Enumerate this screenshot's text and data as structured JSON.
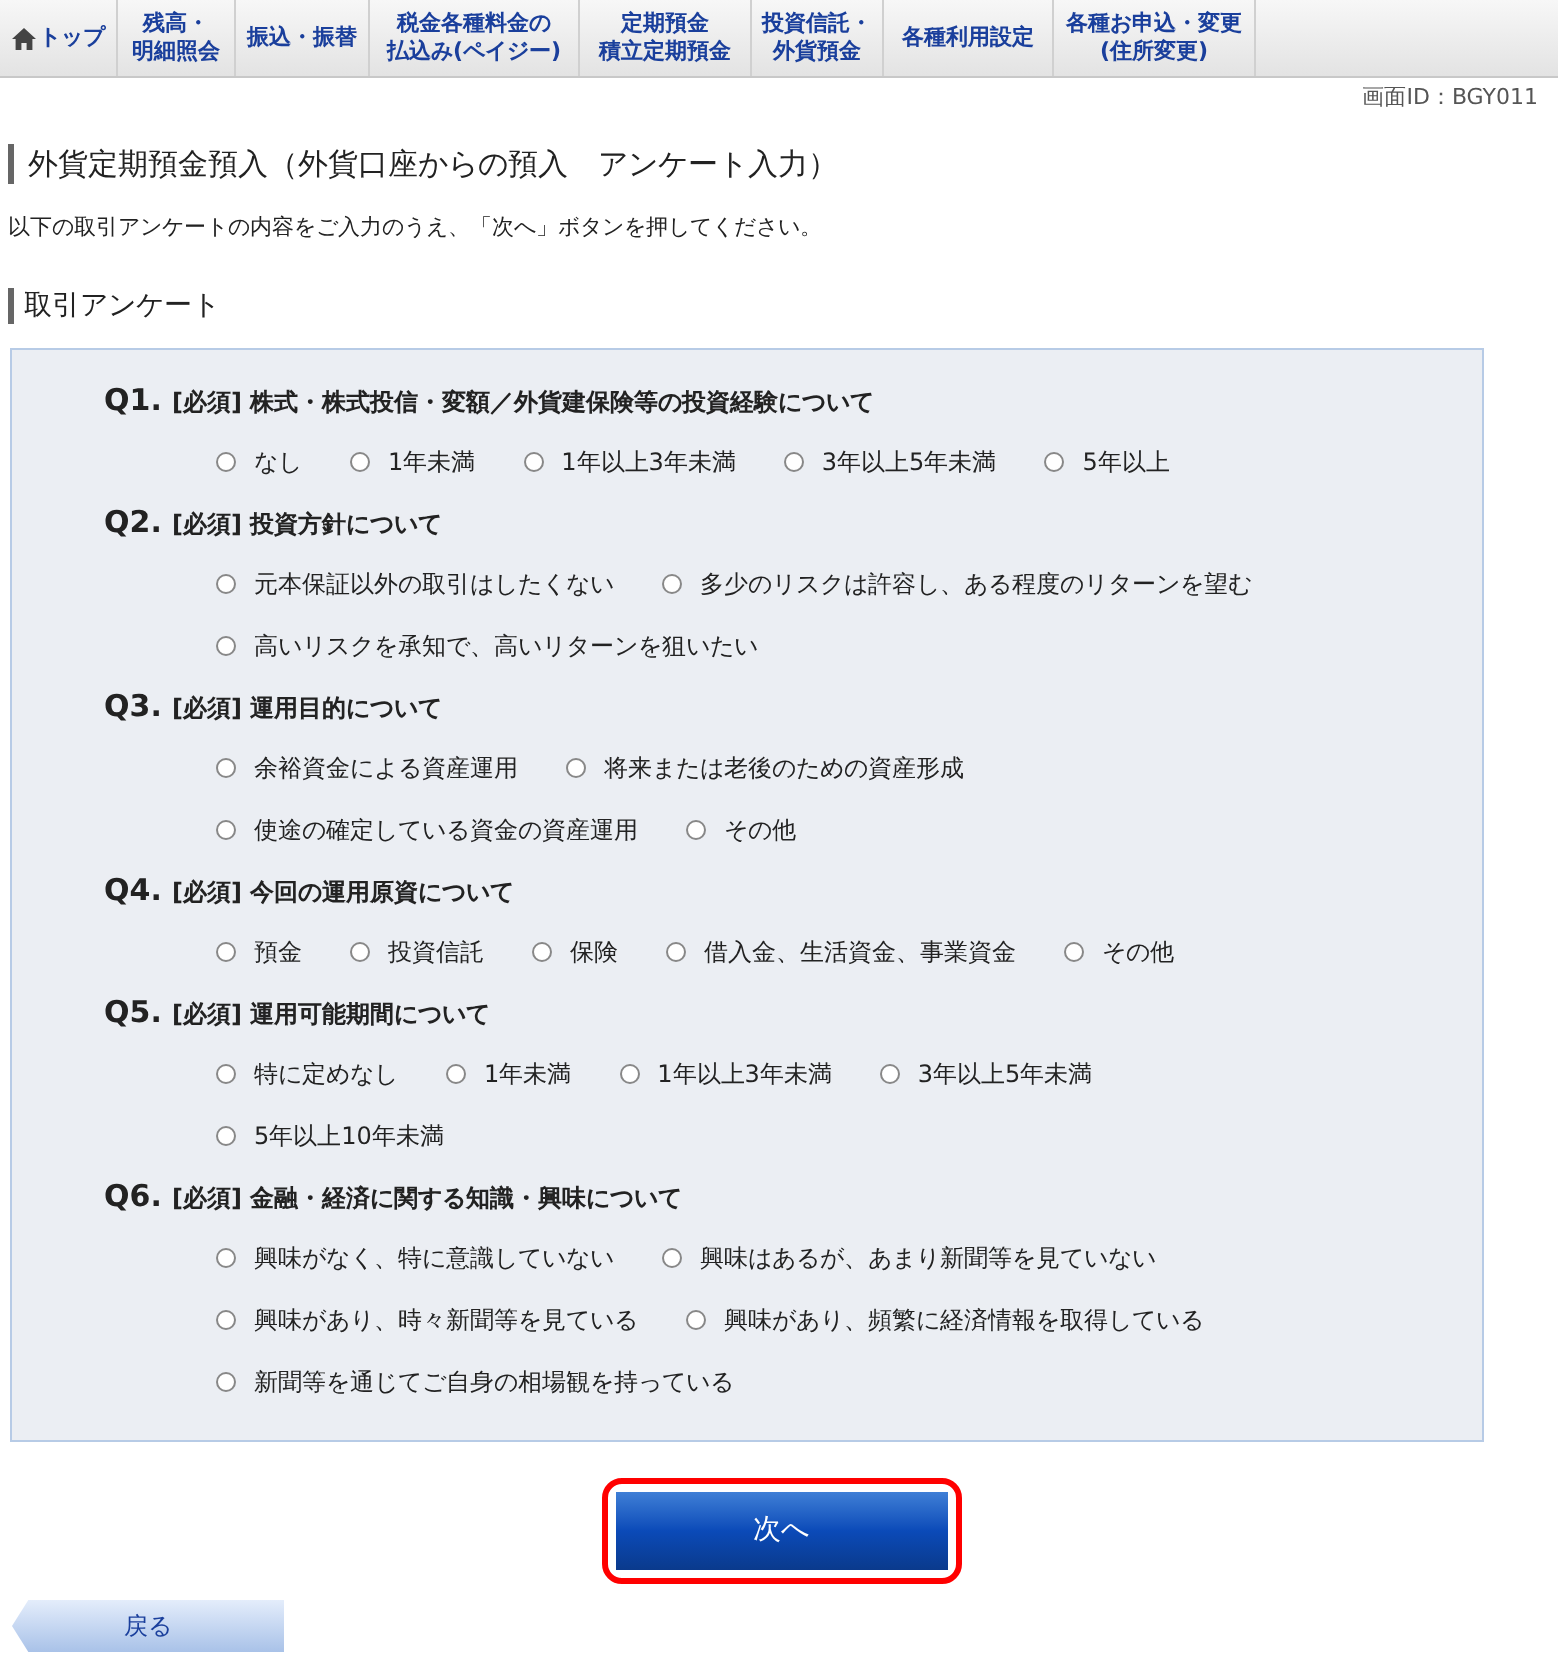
{
  "nav": [
    {
      "lines": [
        "トップ"
      ],
      "kind": "home",
      "selected": false
    },
    {
      "lines": [
        "残高・",
        "明細照会"
      ],
      "selected": false
    },
    {
      "lines": [
        "振込・振替"
      ],
      "selected": false
    },
    {
      "lines": [
        "税金各種料金の",
        "払込み(ペイジー)"
      ],
      "selected": false
    },
    {
      "lines": [
        "定期預金",
        "積立定期預金"
      ],
      "selected": false
    },
    {
      "lines": [
        "投資信託・",
        "外貨預金"
      ],
      "selected": false
    },
    {
      "lines": [
        "各種利用設定"
      ],
      "selected": false
    },
    {
      "lines": [
        "各種お申込・変更",
        "(住所変更)"
      ],
      "selected": false
    }
  ],
  "screen_id": "画面ID：BGY011",
  "title": "外貨定期預金預入（外貨口座からの預入　アンケート入力）",
  "instruction": "以下の取引アンケートの内容をご入力のうえ、「次へ」ボタンを押してください。",
  "section_title": "取引アンケート",
  "questions": [
    {
      "number": "Q1.",
      "required": "[必須]",
      "text": "株式・株式投信・変額／外貨建保険等の投資経験について",
      "option_rows": [
        [
          {
            "label": "なし",
            "selected": false
          },
          {
            "label": "1年未満",
            "selected": false
          },
          {
            "label": "1年以上3年未満",
            "selected": false
          },
          {
            "label": "3年以上5年未満",
            "selected": false
          },
          {
            "label": "5年以上",
            "selected": false
          }
        ]
      ]
    },
    {
      "number": "Q2.",
      "required": "[必須]",
      "text": "投資方針について",
      "option_rows": [
        [
          {
            "label": "元本保証以外の取引はしたくない",
            "selected": false
          },
          {
            "label": "多少のリスクは許容し、ある程度のリターンを望む",
            "selected": false
          }
        ],
        [
          {
            "label": "高いリスクを承知で、高いリターンを狙いたい",
            "selected": false
          }
        ]
      ]
    },
    {
      "number": "Q3.",
      "required": "[必須]",
      "text": "運用目的について",
      "option_rows": [
        [
          {
            "label": "余裕資金による資産運用",
            "selected": false
          },
          {
            "label": "将来または老後のための資産形成",
            "selected": false
          }
        ],
        [
          {
            "label": "使途の確定している資金の資産運用",
            "selected": false
          },
          {
            "label": "その他",
            "selected": false
          }
        ]
      ]
    },
    {
      "number": "Q4.",
      "required": "[必須]",
      "text": "今回の運用原資について",
      "option_rows": [
        [
          {
            "label": "預金",
            "selected": false
          },
          {
            "label": "投資信託",
            "selected": false
          },
          {
            "label": "保険",
            "selected": false
          },
          {
            "label": "借入金、生活資金、事業資金",
            "selected": false
          },
          {
            "label": "その他",
            "selected": false
          }
        ]
      ]
    },
    {
      "number": "Q5.",
      "required": "[必須]",
      "text": "運用可能期間について",
      "option_rows": [
        [
          {
            "label": "特に定めなし",
            "selected": false
          },
          {
            "label": "1年未満",
            "selected": false
          },
          {
            "label": "1年以上3年未満",
            "selected": false
          },
          {
            "label": "3年以上5年未満",
            "selected": false
          }
        ],
        [
          {
            "label": "5年以上10年未満",
            "selected": false
          }
        ]
      ]
    },
    {
      "number": "Q6.",
      "required": "[必須]",
      "text": "金融・経済に関する知識・興味について",
      "option_rows": [
        [
          {
            "label": "興味がなく、特に意識していない",
            "selected": false
          },
          {
            "label": "興味はあるが、あまり新聞等を見ていない",
            "selected": false
          }
        ],
        [
          {
            "label": "興味があり、時々新聞等を見ている",
            "selected": false
          },
          {
            "label": "興味があり、頻繁に経済情報を取得している",
            "selected": false
          }
        ],
        [
          {
            "label": "新聞等を通じてご自身の相場観を持っている",
            "selected": false
          }
        ]
      ]
    }
  ],
  "next_button": {
    "label": "次へ",
    "highlighted": true
  },
  "back_button": {
    "label": "戻る"
  }
}
